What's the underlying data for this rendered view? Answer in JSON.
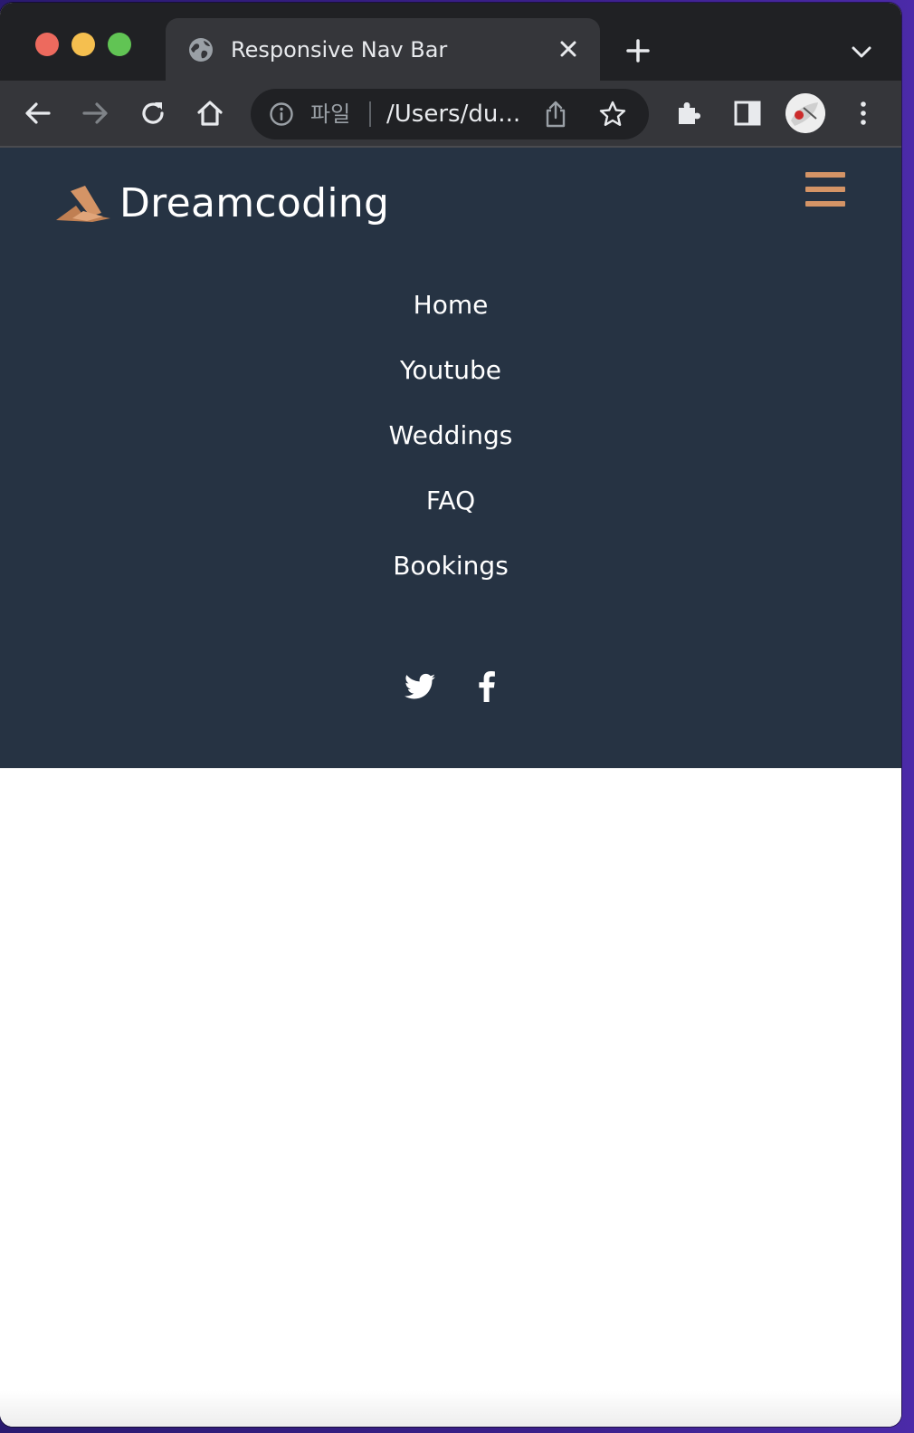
{
  "browser": {
    "tab": {
      "title": "Responsive Nav Bar"
    },
    "omnibox": {
      "scheme_label": "파일",
      "url": "/Users/du..."
    }
  },
  "page": {
    "brand": {
      "name": "Dreamcoding"
    },
    "menu": {
      "items": [
        {
          "label": "Home"
        },
        {
          "label": "Youtube"
        },
        {
          "label": "Weddings"
        },
        {
          "label": "FAQ"
        },
        {
          "label": "Bookings"
        }
      ]
    },
    "social": [
      "twitter-icon",
      "facebook-icon"
    ],
    "colors": {
      "navbar_bg": "#263343",
      "accent": "#d49466",
      "text": "#ffffff"
    }
  }
}
